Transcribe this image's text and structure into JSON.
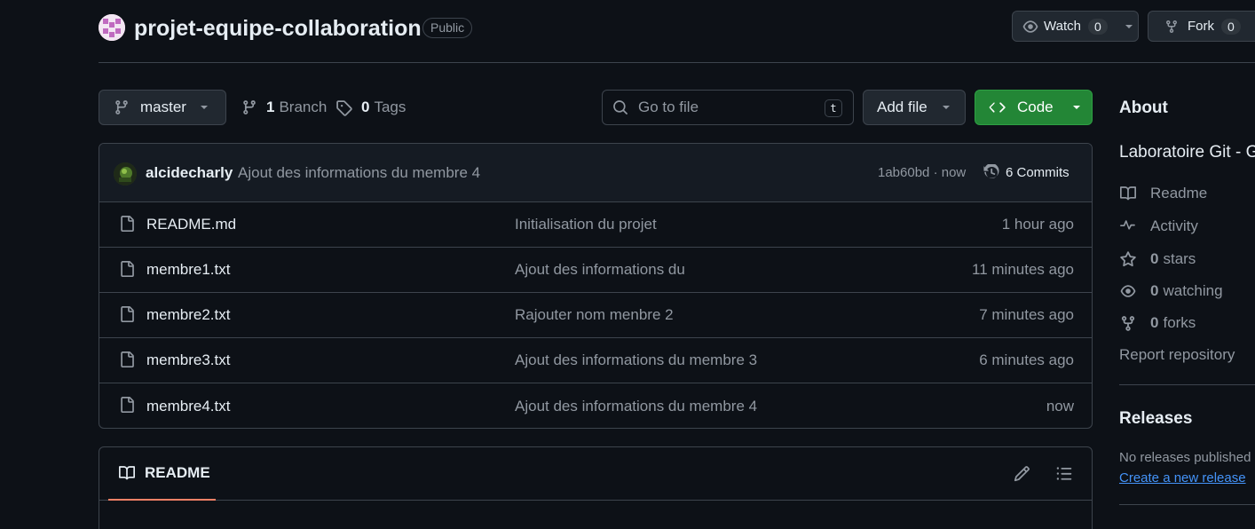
{
  "repo": {
    "name": "projet-equipe-collaboration",
    "visibility": "Public",
    "watch_label": "Watch",
    "watch_count": "0",
    "fork_label": "Fork",
    "fork_count": "0"
  },
  "toolbar": {
    "branch": "master",
    "branch_count": "1",
    "branch_label": "Branch",
    "tag_count": "0",
    "tag_label": "Tags",
    "search_placeholder": "Go to file",
    "search_shortcut": "t",
    "add_file_label": "Add file",
    "code_label": "Code"
  },
  "latest_commit": {
    "author": "alcidecharly",
    "message": "Ajout des informations du membre 4",
    "sha_time": "1ab60bd · now",
    "commits_label": "6 Commits"
  },
  "files": [
    {
      "name": "README.md",
      "message": "Initialisation du projet",
      "time": "1 hour ago"
    },
    {
      "name": "membre1.txt",
      "message": "Ajout des informations du",
      "time": "11 minutes ago"
    },
    {
      "name": "membre2.txt",
      "message": "Rajouter nom menbre 2",
      "time": "7 minutes ago"
    },
    {
      "name": "membre3.txt",
      "message": "Ajout des informations du membre 3",
      "time": "6 minutes ago"
    },
    {
      "name": "membre4.txt",
      "message": "Ajout des informations du membre 4",
      "time": "now"
    }
  ],
  "readme": {
    "tab_label": "README"
  },
  "sidebar": {
    "about_title": "About",
    "description": "Laboratoire Git - G",
    "readme_label": "Readme",
    "activity_label": "Activity",
    "stars_count": "0",
    "stars_label": "stars",
    "watching_count": "0",
    "watching_label": "watching",
    "forks_count": "0",
    "forks_label": "forks",
    "report_label": "Report repository",
    "releases_title": "Releases",
    "no_releases": "No releases published",
    "create_release": "Create a new release"
  },
  "colors": {
    "background": "#0d1117",
    "accent_green": "#238636",
    "link_blue": "#4493f8",
    "underline_orange": "#f78166"
  }
}
